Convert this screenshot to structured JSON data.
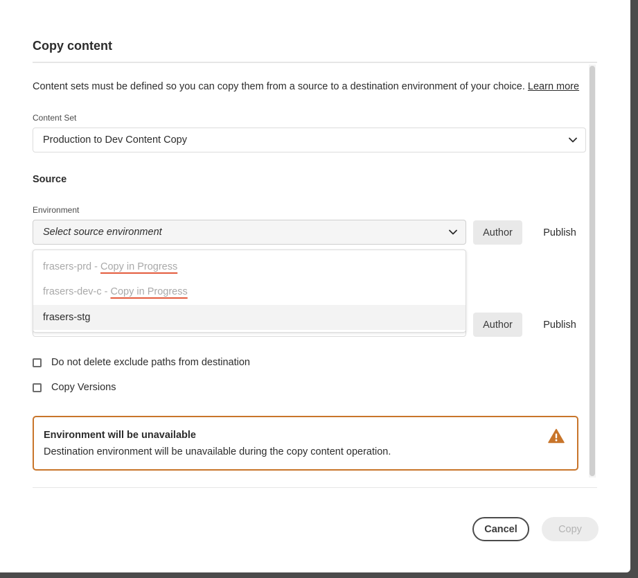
{
  "dialog": {
    "title": "Copy content",
    "description": "Content sets must be defined so you can copy them from a source to a destination environment of your choice.",
    "learn_more": "Learn more"
  },
  "content_set": {
    "label": "Content Set",
    "value": "Production to Dev Content Copy"
  },
  "source": {
    "heading": "Source",
    "environment_label": "Environment",
    "environment_placeholder": "Select source environment",
    "author_label": "Author",
    "publish_label": "Publish"
  },
  "dropdown": {
    "items": [
      {
        "name": "frasers-prd",
        "separator": " - ",
        "status": "Copy in Progress",
        "disabled": true
      },
      {
        "name": "frasers-dev-c",
        "separator": " - ",
        "status": "Copy in Progress",
        "disabled": true
      },
      {
        "name": "frasers-stg",
        "separator": "",
        "status": "",
        "disabled": false
      }
    ]
  },
  "destination": {
    "author_label": "Author",
    "publish_label": "Publish"
  },
  "options": {
    "no_delete_label": "Do not delete exclude paths from destination",
    "copy_versions_label": "Copy Versions"
  },
  "alert": {
    "title": "Environment will be unavailable",
    "body": "Destination environment will be unavailable during the copy content operation.",
    "icon": "warning-icon",
    "color": "#c8752a"
  },
  "footer": {
    "cancel_label": "Cancel",
    "copy_label": "Copy"
  }
}
